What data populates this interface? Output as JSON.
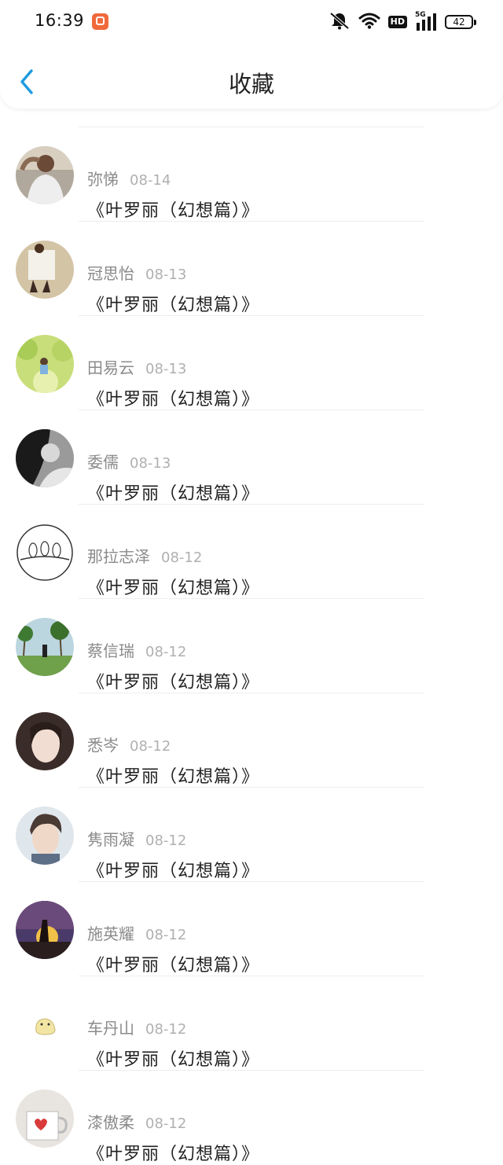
{
  "status_bar": {
    "time": "16:39",
    "network_type": "5G",
    "hd_label": "HD",
    "battery": "42"
  },
  "nav": {
    "title": "收藏"
  },
  "items": [
    {
      "name": "弥悌",
      "date": "08-14",
      "title": "《叶罗丽（幻想篇）》"
    },
    {
      "name": "冠思怡",
      "date": "08-13",
      "title": "《叶罗丽（幻想篇）》"
    },
    {
      "name": "田易云",
      "date": "08-13",
      "title": "《叶罗丽（幻想篇）》"
    },
    {
      "name": "委儒",
      "date": "08-13",
      "title": "《叶罗丽（幻想篇）》"
    },
    {
      "name": "那拉志泽",
      "date": "08-12",
      "title": "《叶罗丽（幻想篇）》"
    },
    {
      "name": "蔡信瑞",
      "date": "08-12",
      "title": "《叶罗丽（幻想篇）》"
    },
    {
      "name": "悉岑",
      "date": "08-12",
      "title": "《叶罗丽（幻想篇）》"
    },
    {
      "name": "隽雨凝",
      "date": "08-12",
      "title": "《叶罗丽（幻想篇）》"
    },
    {
      "name": "施英耀",
      "date": "08-12",
      "title": "《叶罗丽（幻想篇）》"
    },
    {
      "name": "车丹山",
      "date": "08-12",
      "title": "《叶罗丽（幻想篇）》"
    },
    {
      "name": "漆傲柔",
      "date": "08-12",
      "title": "《叶罗丽（幻想篇）》"
    }
  ],
  "icons": {
    "back": "chevron-left-icon",
    "mute": "bell-mute-icon",
    "wifi": "wifi-icon",
    "signal": "signal-bars-icon",
    "battery": "battery-icon"
  },
  "colors": {
    "accent": "#1e9be0",
    "name_text": "#8a8a8a",
    "date_text": "#b0b0b0",
    "title_text": "#1f1f1f"
  }
}
